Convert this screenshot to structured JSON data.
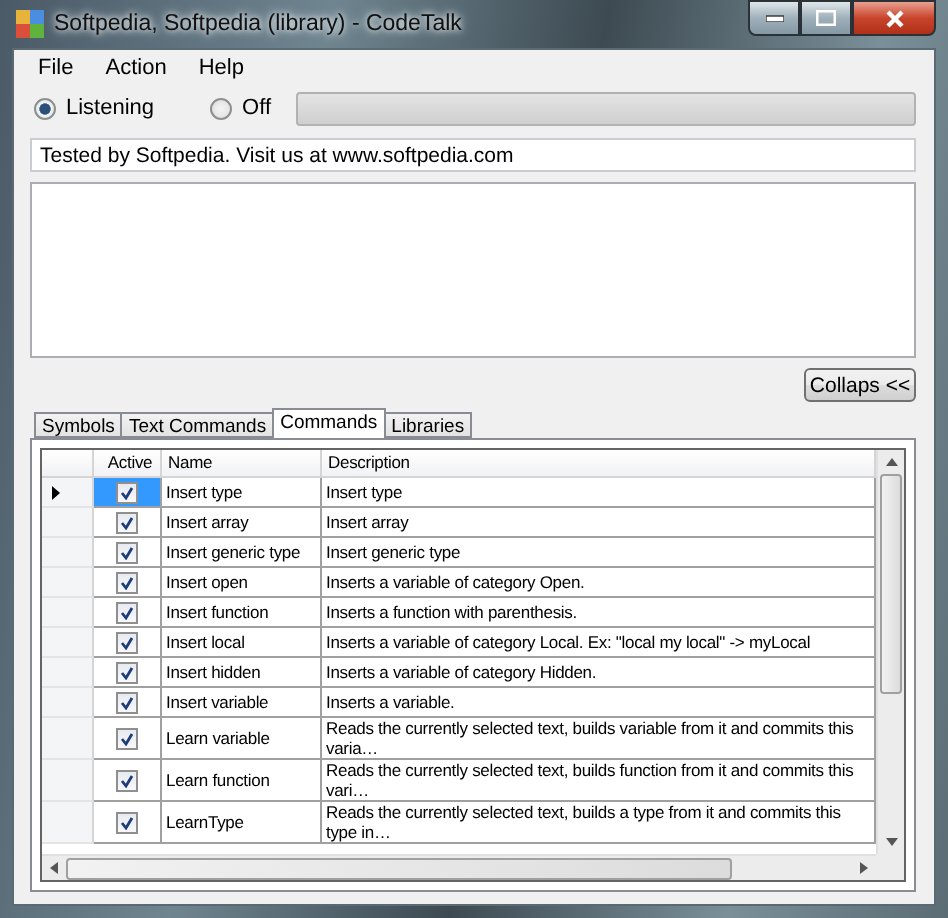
{
  "window": {
    "title": "Softpedia, Softpedia (library) - CodeTalk"
  },
  "menu": [
    "File",
    "Action",
    "Help"
  ],
  "mode": [
    {
      "label": "Listening",
      "selected": true
    },
    {
      "label": "Off",
      "selected": false
    }
  ],
  "progress": {
    "level": 0
  },
  "info_field": {
    "value": "Tested by Softpedia. Visit us at www.softpedia.com"
  },
  "collapse_button": "Collaps <<",
  "tabs": [
    {
      "label": "Symbols",
      "selected": false
    },
    {
      "label": "Text Commands",
      "selected": false
    },
    {
      "label": "Commands",
      "selected": true
    },
    {
      "label": "Libraries",
      "selected": false
    }
  ],
  "table": {
    "columns": [
      "Active",
      "Name",
      "Description"
    ],
    "rows": [
      {
        "selected": true,
        "active": true,
        "name": "Insert type",
        "description": "Insert type"
      },
      {
        "selected": false,
        "active": true,
        "name": "Insert array",
        "description": "Insert array"
      },
      {
        "selected": false,
        "active": true,
        "name": "Insert generic type",
        "description": "Insert generic type"
      },
      {
        "selected": false,
        "active": true,
        "name": "Insert open",
        "description": "Inserts a variable of category Open."
      },
      {
        "selected": false,
        "active": true,
        "name": "Insert function",
        "description": "Inserts a function with parenthesis."
      },
      {
        "selected": false,
        "active": true,
        "name": "Insert local",
        "description": "Inserts a variable of category Local. Ex: \"local my local\" -> myLocal"
      },
      {
        "selected": false,
        "active": true,
        "name": "Insert hidden",
        "description": "Inserts a variable of category Hidden."
      },
      {
        "selected": false,
        "active": true,
        "name": "Insert variable",
        "description": "Inserts a variable."
      },
      {
        "selected": false,
        "active": true,
        "name": "Learn variable",
        "description": "Reads the currently selected text, builds variable from it and commits this varia…"
      },
      {
        "selected": false,
        "active": true,
        "name": "Learn function",
        "description": "Reads the currently selected text, builds function from it and commits this vari…"
      },
      {
        "selected": false,
        "active": true,
        "name": "LearnType",
        "description": "Reads the currently selected text, builds a type from it and commits this type in…"
      }
    ]
  }
}
